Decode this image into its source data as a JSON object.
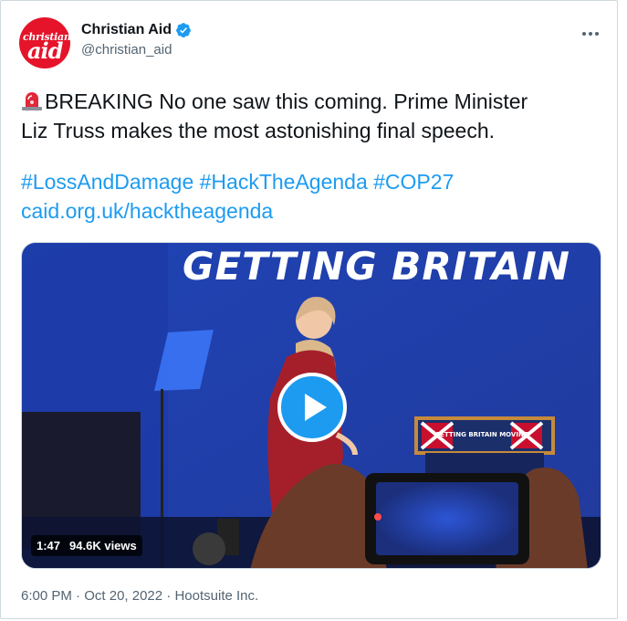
{
  "author": {
    "display_name": "Christian Aid",
    "handle": "@christian_aid",
    "avatar_text_top": "christian",
    "avatar_text_bottom": "aid",
    "verified": true,
    "brand_color": "#e5142a"
  },
  "tweet": {
    "emoji": "siren-icon",
    "line1": "BREAKING No one saw this coming. Prime Minister",
    "line2": "Liz Truss makes the most astonishing final speech.",
    "hashtags": [
      "#LossAndDamage",
      "#HackTheAgenda",
      "#COP27"
    ],
    "link": "caid.org.uk/hacktheagenda",
    "link_color": "#1d9bf0"
  },
  "media": {
    "backdrop_text": "GETTING BRITAIN",
    "lectern_text": "GETTING BRITAIN MOVING",
    "duration": "1:47",
    "views": "94.6K views"
  },
  "footer": {
    "time": "6:00 PM",
    "separator1": "·",
    "date": "Oct 20, 2022",
    "separator2": "·",
    "source": "Hootsuite Inc."
  }
}
